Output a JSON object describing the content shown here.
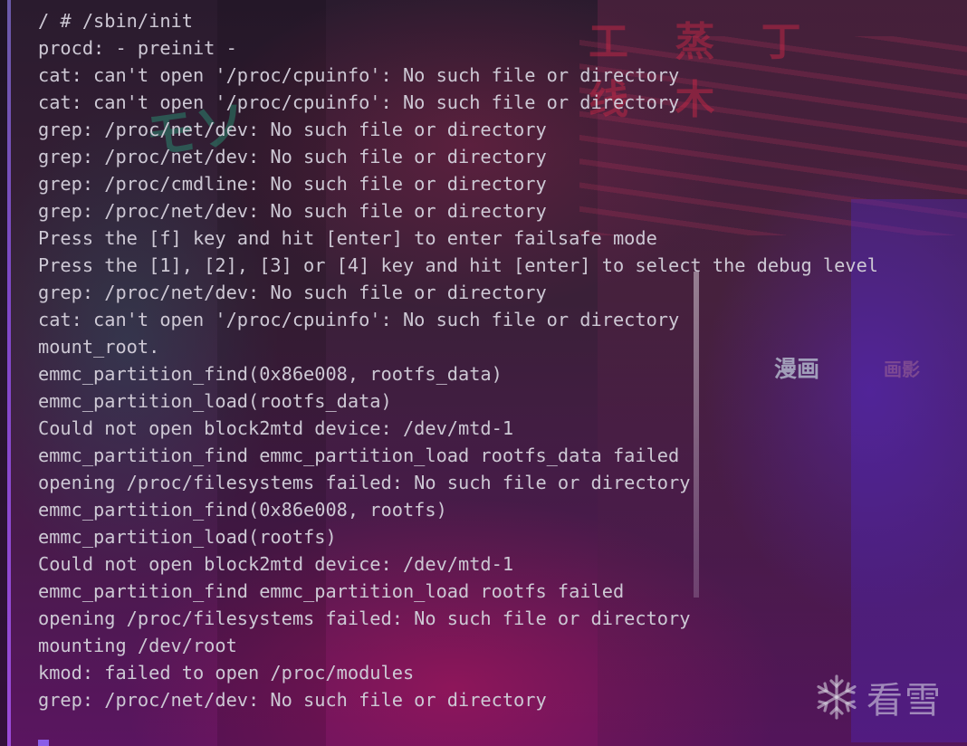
{
  "background": {
    "sign_text_1": "漫画",
    "sign_text_2": "画影"
  },
  "terminal": {
    "lines": [
      "/ # /sbin/init",
      "procd: - preinit -",
      "cat: can't open '/proc/cpuinfo': No such file or directory",
      "cat: can't open '/proc/cpuinfo': No such file or directory",
      "grep: /proc/net/dev: No such file or directory",
      "grep: /proc/net/dev: No such file or directory",
      "grep: /proc/cmdline: No such file or directory",
      "grep: /proc/net/dev: No such file or directory",
      "Press the [f] key and hit [enter] to enter failsafe mode",
      "Press the [1], [2], [3] or [4] key and hit [enter] to select the debug level",
      "grep: /proc/net/dev: No such file or directory",
      "cat: can't open '/proc/cpuinfo': No such file or directory",
      "mount_root.",
      "emmc_partition_find(0x86e008, rootfs_data)",
      "emmc_partition_load(rootfs_data)",
      "Could not open block2mtd device: /dev/mtd-1",
      "emmc_partition_find emmc_partition_load rootfs_data failed",
      "opening /proc/filesystems failed: No such file or directory",
      "emmc_partition_find(0x86e008, rootfs)",
      "emmc_partition_load(rootfs)",
      "Could not open block2mtd device: /dev/mtd-1",
      "emmc_partition_find emmc_partition_load rootfs failed",
      "opening /proc/filesystems failed: No such file or directory",
      "mounting /dev/root",
      "kmod: failed to open /proc/modules",
      "grep: /proc/net/dev: No such file or directory"
    ],
    "text_color": "#cdc8d4",
    "cursor_color": "#8a5ee8"
  },
  "watermark": {
    "icon": "snowflake-icon",
    "text": "看雪"
  }
}
